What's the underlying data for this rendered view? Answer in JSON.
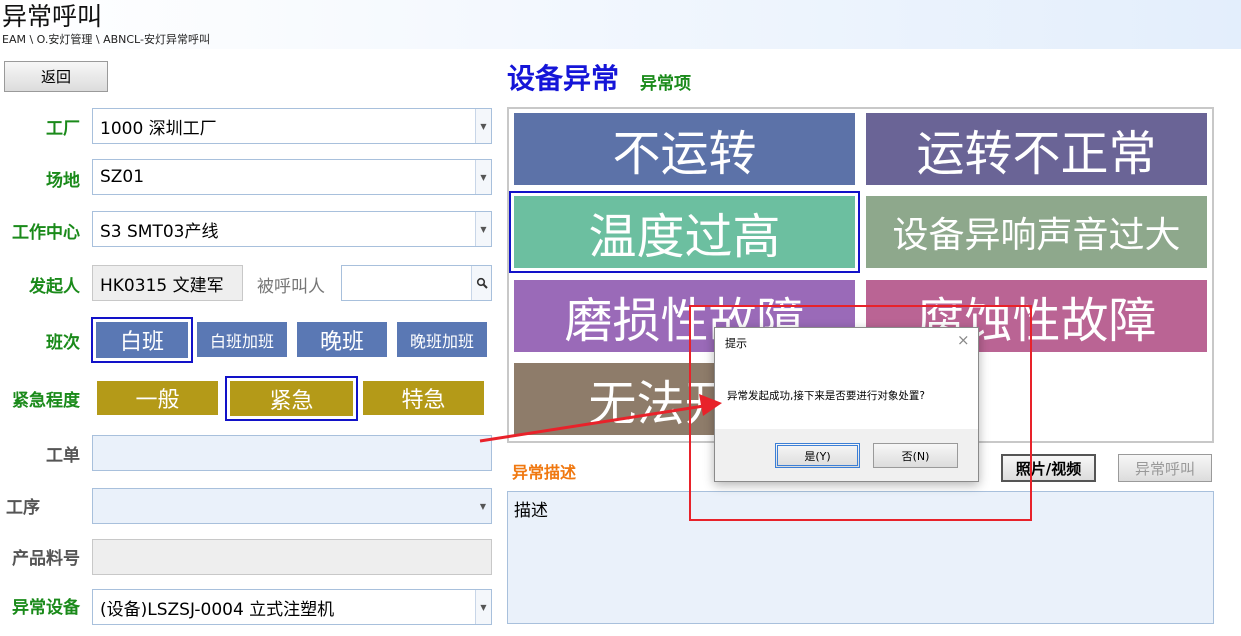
{
  "header": {
    "title": "异常呼叫",
    "breadcrumb": "EAM \\ O.安灯管理 \\ ABNCL-安灯异常呼叫"
  },
  "toolbar": {
    "back_label": "返回"
  },
  "form": {
    "factory": {
      "label": "工厂",
      "value": "1000 深圳工厂"
    },
    "site": {
      "label": "场地",
      "value": "SZ01"
    },
    "work_center": {
      "label": "工作中心",
      "value": "S3 SMT03产线"
    },
    "initiator": {
      "label": "发起人",
      "value": "HK0315 文建军"
    },
    "callee": {
      "label": "被呼叫人",
      "value": ""
    },
    "shift": {
      "label": "班次",
      "options": [
        "白班",
        "白班加班",
        "晚班",
        "晚班加班"
      ],
      "selected": "白班"
    },
    "urgency": {
      "label": "紧急程度",
      "options": [
        "一般",
        "紧急",
        "特急"
      ],
      "selected": "紧急"
    },
    "work_order": {
      "label": "工单",
      "value": ""
    },
    "process": {
      "label": "工序",
      "value": ""
    },
    "product_no": {
      "label": "产品料号",
      "value": ""
    },
    "equipment": {
      "label": "异常设备",
      "value": "(设备)LSZSJ-0004 立式注塑机"
    }
  },
  "right": {
    "title": "设备异常",
    "subtitle": "异常项",
    "items": [
      {
        "label": "不运转",
        "color": "#5c72a8"
      },
      {
        "label": "运转不正常",
        "color": "#6a6496"
      },
      {
        "label": "温度过高",
        "color": "#6cbfa0",
        "selected": true
      },
      {
        "label": "设备异响声音过大",
        "color": "#8ea88c"
      },
      {
        "label": "磨损性故障",
        "color": "#9a6ab8"
      },
      {
        "label": "腐蚀性故障",
        "color": "#ba6494"
      },
      {
        "label": "无法开机",
        "color": "#8e7c6a"
      }
    ],
    "desc_label": "异常描述",
    "desc_value": "描述",
    "photo_button": "照片/视频",
    "call_button": "异常呼叫"
  },
  "dialog": {
    "title": "提示",
    "message": "异常发起成功,接下来是否要进行对象处置?",
    "yes_label": "是(Y)",
    "no_label": "否(N)"
  },
  "annotation": {
    "box_color": "#e8222a",
    "arrow_color": "#e8222a"
  }
}
